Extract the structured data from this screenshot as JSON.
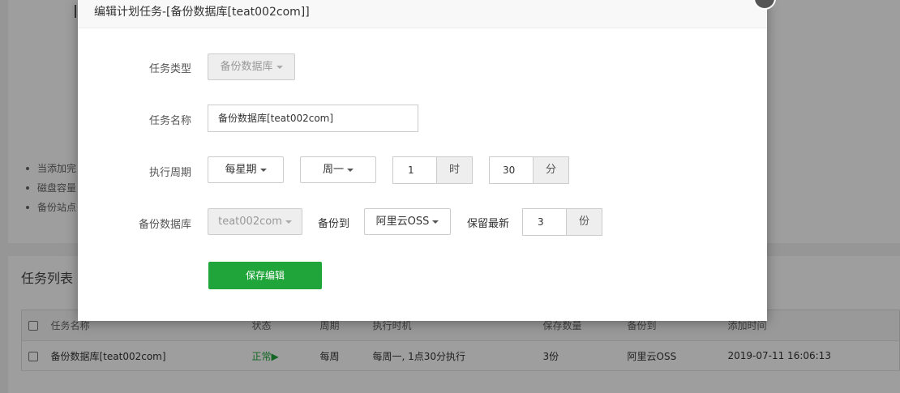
{
  "background": {
    "tips": [
      "当添加完",
      "磁盘容量",
      "备份站点"
    ],
    "list_title": "任务列表",
    "table": {
      "headers": [
        "任务名称",
        "状态",
        "周期",
        "执行时机",
        "保存数量",
        "备份到",
        "添加时间"
      ],
      "rows": [
        {
          "name": "备份数据库[teat002com]",
          "status": "正常",
          "status_icon": "▶",
          "cycle": "每周",
          "timing": "每周一, 1点30分执行",
          "keep": "3份",
          "backup_to": "阿里云OSS",
          "added": "2019-07-11 16:06:13"
        }
      ]
    }
  },
  "modal": {
    "title": "编辑计划任务-[备份数据库[teat002com]]",
    "fields": {
      "task_type_label": "任务类型",
      "task_type_value": "备份数据库",
      "task_name_label": "任务名称",
      "task_name_value": "备份数据库[teat002com]",
      "cycle_label": "执行周期",
      "cycle_value": "每星期",
      "weekday_value": "周一",
      "hour_value": "1",
      "hour_unit": "时",
      "minute_value": "30",
      "minute_unit": "分",
      "db_label": "备份数据库",
      "db_value": "teat002com",
      "backup_to_label": "备份到",
      "backup_to_value": "阿里云OSS",
      "keep_label": "保留最新",
      "keep_value": "3",
      "keep_unit": "份"
    },
    "save_label": "保存编辑"
  },
  "colors": {
    "accent_green": "#20a53a"
  }
}
